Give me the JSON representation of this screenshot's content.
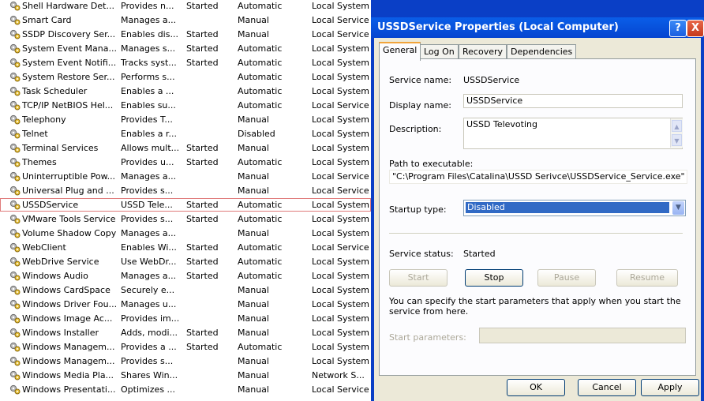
{
  "services": [
    {
      "name": "Shell Hardware Det...",
      "description": "Provides n...",
      "status": "Started",
      "startup": "Automatic",
      "logon": "Local System"
    },
    {
      "name": "Smart Card",
      "description": "Manages a...",
      "status": "",
      "startup": "Manual",
      "logon": "Local Service"
    },
    {
      "name": "SSDP Discovery Ser...",
      "description": "Enables dis...",
      "status": "Started",
      "startup": "Manual",
      "logon": "Local Service"
    },
    {
      "name": "System Event Mana...",
      "description": "Manages s...",
      "status": "Started",
      "startup": "Automatic",
      "logon": "Local System"
    },
    {
      "name": "System Event Notifi...",
      "description": "Tracks syst...",
      "status": "Started",
      "startup": "Automatic",
      "logon": "Local System"
    },
    {
      "name": "System Restore Ser...",
      "description": "Performs s...",
      "status": "",
      "startup": "Automatic",
      "logon": "Local System"
    },
    {
      "name": "Task Scheduler",
      "description": "Enables a ...",
      "status": "",
      "startup": "Automatic",
      "logon": "Local System"
    },
    {
      "name": "TCP/IP NetBIOS Hel...",
      "description": "Enables su...",
      "status": "",
      "startup": "Automatic",
      "logon": "Local Service"
    },
    {
      "name": "Telephony",
      "description": "Provides T...",
      "status": "",
      "startup": "Manual",
      "logon": "Local System"
    },
    {
      "name": "Telnet",
      "description": "Enables a r...",
      "status": "",
      "startup": "Disabled",
      "logon": "Local System"
    },
    {
      "name": "Terminal Services",
      "description": "Allows mult...",
      "status": "Started",
      "startup": "Manual",
      "logon": "Local System"
    },
    {
      "name": "Themes",
      "description": "Provides u...",
      "status": "Started",
      "startup": "Automatic",
      "logon": "Local System"
    },
    {
      "name": "Uninterruptible Pow...",
      "description": "Manages a...",
      "status": "",
      "startup": "Manual",
      "logon": "Local Service"
    },
    {
      "name": "Universal Plug and ...",
      "description": "Provides s...",
      "status": "",
      "startup": "Manual",
      "logon": "Local Service"
    },
    {
      "name": "USSDService",
      "description": "USSD Tele...",
      "status": "Started",
      "startup": "Automatic",
      "logon": "Local System"
    },
    {
      "name": "VMware Tools Service",
      "description": "Provides s...",
      "status": "Started",
      "startup": "Automatic",
      "logon": "Local System"
    },
    {
      "name": "Volume Shadow Copy",
      "description": "Manages a...",
      "status": "",
      "startup": "Manual",
      "logon": "Local System"
    },
    {
      "name": "WebClient",
      "description": "Enables Wi...",
      "status": "Started",
      "startup": "Automatic",
      "logon": "Local Service"
    },
    {
      "name": "WebDrive Service",
      "description": "Use WebDr...",
      "status": "Started",
      "startup": "Automatic",
      "logon": "Local System"
    },
    {
      "name": "Windows Audio",
      "description": "Manages a...",
      "status": "Started",
      "startup": "Automatic",
      "logon": "Local System"
    },
    {
      "name": "Windows CardSpace",
      "description": "Securely e...",
      "status": "",
      "startup": "Manual",
      "logon": "Local System"
    },
    {
      "name": "Windows Driver Fou...",
      "description": "Manages u...",
      "status": "",
      "startup": "Manual",
      "logon": "Local System"
    },
    {
      "name": "Windows Image Ac...",
      "description": "Provides im...",
      "status": "",
      "startup": "Manual",
      "logon": "Local System"
    },
    {
      "name": "Windows Installer",
      "description": "Adds, modi...",
      "status": "Started",
      "startup": "Manual",
      "logon": "Local System"
    },
    {
      "name": "Windows Managem...",
      "description": "Provides a ...",
      "status": "Started",
      "startup": "Automatic",
      "logon": "Local System"
    },
    {
      "name": "Windows Managem...",
      "description": "Provides s...",
      "status": "",
      "startup": "Manual",
      "logon": "Local System"
    },
    {
      "name": "Windows Media Pla...",
      "description": "Shares Win...",
      "status": "",
      "startup": "Manual",
      "logon": "Network S..."
    },
    {
      "name": "Windows Presentati...",
      "description": "Optimizes ...",
      "status": "",
      "startup": "Manual",
      "logon": "Local Service"
    }
  ],
  "selected_service": "USSDService",
  "dialog": {
    "title": "USSDService Properties (Local Computer)",
    "help_glyph": "?",
    "close_glyph": "X",
    "tabs": [
      "General",
      "Log On",
      "Recovery",
      "Dependencies"
    ],
    "active_tab": "General",
    "service_name_label": "Service name:",
    "service_name_value": "USSDService",
    "display_name_label": "Display name:",
    "display_name_value": "USSDService",
    "description_label": "Description:",
    "description_value": "USSD Televoting",
    "path_label": "Path to executable:",
    "path_value": "\"C:\\Program Files\\Catalina\\USSD Serivce\\USSDService_Service.exe\"",
    "startup_type_label": "Startup type:",
    "startup_type_value": "Disabled",
    "service_status_label": "Service status:",
    "service_status_value": "Started",
    "buttons": {
      "start": "Start",
      "stop": "Stop",
      "pause": "Pause",
      "resume": "Resume"
    },
    "hint_text": "You can specify the start parameters that apply when you start the service from here.",
    "start_params_label": "Start parameters:",
    "start_params_value": "",
    "footer": {
      "ok": "OK",
      "cancel": "Cancel",
      "apply": "Apply"
    }
  },
  "colors": {
    "title_bar": "#0a5ee8",
    "selection": "#316ac5",
    "dialog_face": "#ece9d8"
  },
  "icons": {
    "service": "gear-icon",
    "help": "help-icon",
    "close": "close-icon",
    "dropdown": "chevron-down-icon"
  }
}
